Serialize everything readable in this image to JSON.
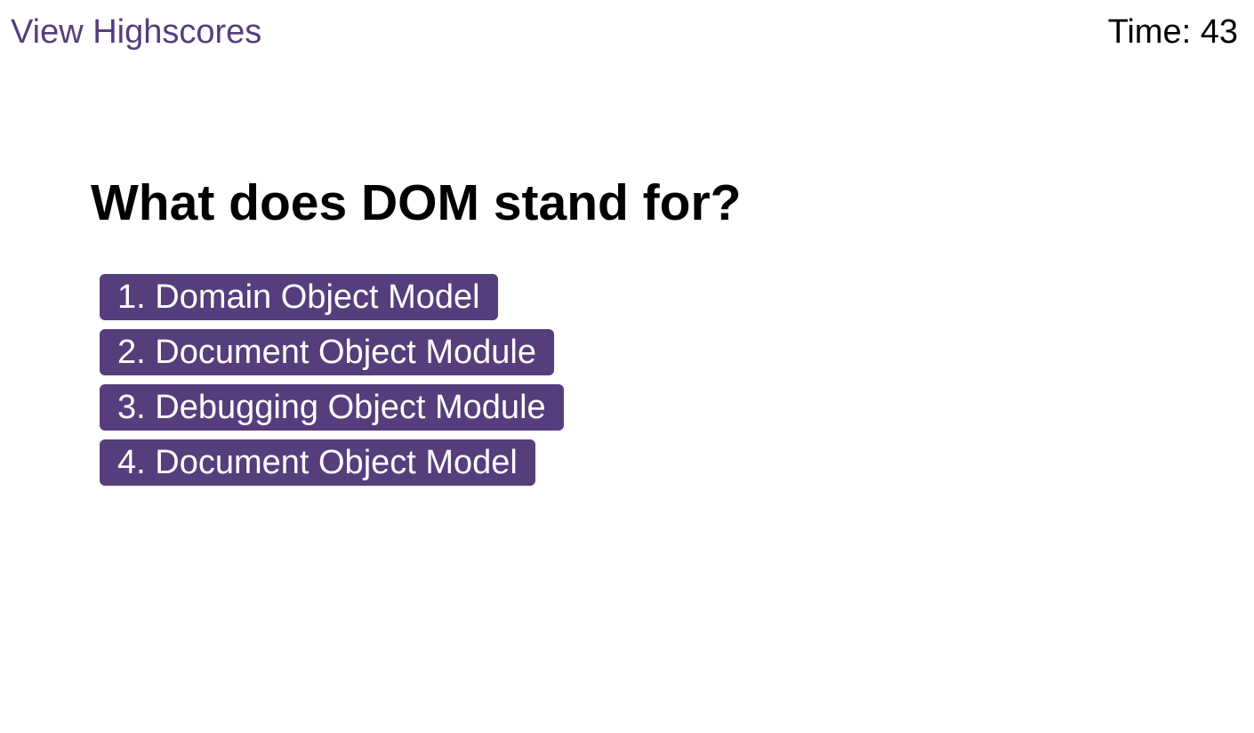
{
  "header": {
    "highscores_label": "View Highscores",
    "timer_label": "Time:",
    "timer_value": "43"
  },
  "quiz": {
    "question": "What does DOM stand for?",
    "answers": [
      "1. Domain Object Model",
      "2. Document Object Module",
      "3. Debugging Object Module",
      "4. Document Object Model"
    ]
  },
  "colors": {
    "accent": "#563d7c",
    "button_text": "#ffffff",
    "text": "#000000",
    "background": "#ffffff"
  }
}
